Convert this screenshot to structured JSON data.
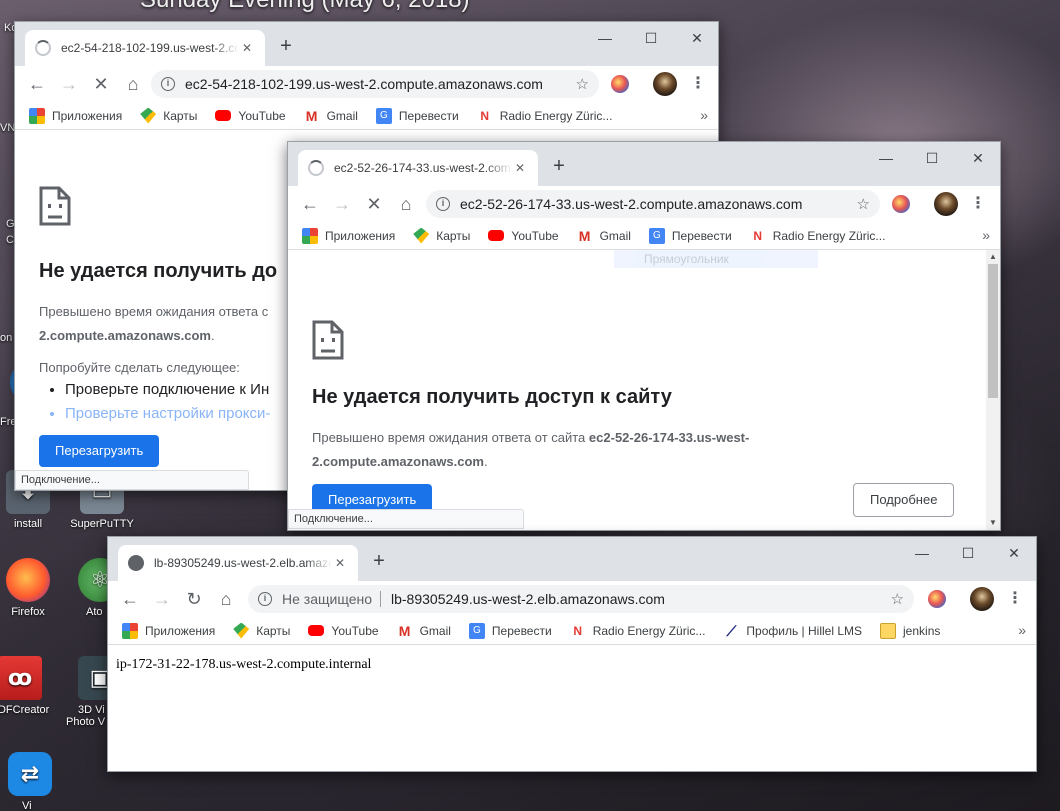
{
  "desktop": {
    "title": "Sunday Evening (May 6, 2018)",
    "icons": {
      "install": "install",
      "superputty": "SuperPuTTY",
      "firefox": "Firefox",
      "atom": "Ato",
      "pdfcreator": "PDFCreator",
      "viewer_line1": "3D Vi",
      "viewer_line2": "Photo V"
    },
    "frags": {
      "f1": "Ko",
      "f2": "VNC",
      "f3": "G",
      "f4": "C",
      "f5": "on",
      "f6": "Fre",
      "f7": "Vi"
    }
  },
  "window1": {
    "tab_title": "ec2-54-218-102-199.us-west-2.compute.amazonaws.com",
    "url": "ec2-54-218-102-199.us-west-2.compute.amazonaws.com",
    "error_title": "Не удается получить до",
    "error_desc_prefix": "Превышено время ожидания ответа с",
    "error_desc_host_tail": "2.compute.amazonaws.com",
    "try_label": "Попробуйте сделать следующее:",
    "suggestions": [
      "Проверьте подключение к Ин",
      "Проверьте настройки прокси-"
    ],
    "reload_label": "Перезагрузить",
    "status_text": "Подключение..."
  },
  "window2": {
    "tab_title": "ec2-52-26-174-33.us-west-2.compute.amazonaws.com",
    "url": "ec2-52-26-174-33.us-west-2.compute.amazonaws.com",
    "ghost_tooltip": "Прямоугольник",
    "error_title": "Не удается получить доступ к сайту",
    "error_desc_prefix": "Превышено время ожидания ответа от сайта",
    "error_host_bold_1": "ec2-52-26-174-33.us-west-",
    "error_host_bold_2": "2.compute.amazonaws.com",
    "reload_label": "Перезагрузить",
    "details_label": "Подробнее",
    "status_text": "Подключение..."
  },
  "window3": {
    "tab_title": "lb-89305249.us-west-2.elb.amazonaws.com",
    "insecure_label": "Не защищено",
    "url": "lb-89305249.us-west-2.elb.amazonaws.com",
    "body_text": "ip-172-31-22-178.us-west-2.compute.internal"
  },
  "bookmarks": {
    "apps": "Приложения",
    "maps": "Карты",
    "youtube": "YouTube",
    "gmail": "Gmail",
    "translate": "Перевести",
    "radio": "Radio Energy Züric...",
    "hillel": "Профиль | Hillel LMS",
    "jenkins": "jenkins",
    "more": "»"
  },
  "glyphs": {
    "back": "←",
    "forward": "→",
    "stop": "✕",
    "reload": "↻",
    "home": "⌂",
    "star": "☆",
    "menu": "⋮",
    "newtab": "+",
    "close": "✕",
    "minimize": "—",
    "maximize": "☐",
    "winclose": "✕"
  },
  "colors": {
    "tabbar": "#dee1e6",
    "blue_button": "#1a73e8",
    "link": "#8ab4f8"
  }
}
